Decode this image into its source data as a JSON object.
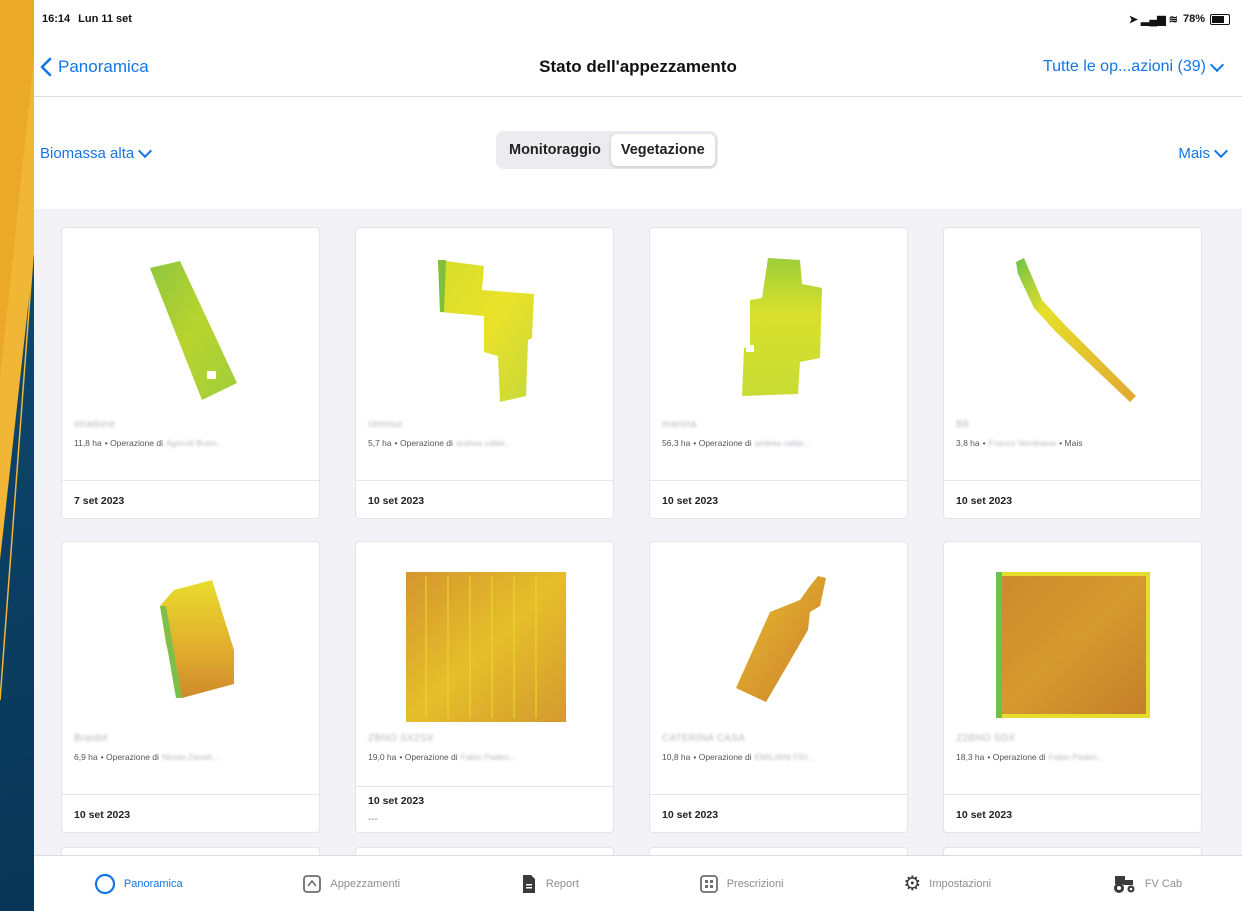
{
  "status_bar": {
    "time": "16:14",
    "date": "Lun 11 set",
    "signal": "↗ .  ıl ◠",
    "battery": "78%"
  },
  "navbar": {
    "back_label": "Panoramica",
    "title": "Stato dell'appezzamento",
    "operations_filter": "Tutte le op...azioni (39)"
  },
  "filters": {
    "layer": "Biomassa alta",
    "segments": [
      {
        "label": "Monitoraggio",
        "active": false
      },
      {
        "label": "Vegetazione",
        "active": true
      }
    ],
    "crop": "Mais"
  },
  "cards": [
    {
      "name": "stradone",
      "area": "11,8 ha",
      "op": "• Operazione di",
      "user": "Agricoli Bram...",
      "suffix": "",
      "date": "7 set 2023",
      "extra": ""
    },
    {
      "name": "cemour",
      "area": "5,7 ha",
      "op": "• Operazione di",
      "user": "andrea callar...",
      "suffix": "",
      "date": "10 set 2023",
      "extra": ""
    },
    {
      "name": "manina",
      "area": "56,3 ha",
      "op": "• Operazione di",
      "user": "andrea callar...",
      "suffix": "",
      "date": "10 set 2023",
      "extra": ""
    },
    {
      "name": "B8",
      "area": "3,8 ha",
      "op": "•",
      "user": "Franco Vendrame",
      "suffix": "• Mais",
      "date": "10 set 2023",
      "extra": ""
    },
    {
      "name": "Braidot",
      "area": "6,9 ha",
      "op": "• Operazione di",
      "user": "Nicola Zanett...",
      "suffix": "",
      "date": "10 set 2023",
      "extra": ""
    },
    {
      "name": "ZBNO SX2SX",
      "area": "19,0 ha",
      "op": "• Operazione di",
      "user": "Fabio Paderi...",
      "suffix": "",
      "date": "10 set 2023",
      "extra": "---"
    },
    {
      "name": "CATERINA CASA",
      "area": "10,8 ha",
      "op": "• Operazione di",
      "user": "EMILIANI FIO...",
      "suffix": "",
      "date": "10 set 2023",
      "extra": ""
    },
    {
      "name": "Z2BNO SDX",
      "area": "18,3 ha",
      "op": "• Operazione di",
      "user": "Fabio Paderi...",
      "suffix": "",
      "date": "10 set 2023",
      "extra": ""
    }
  ],
  "tabs": [
    {
      "label": "Panoramica",
      "icon": "circle-icon",
      "active": true
    },
    {
      "label": "Appezzamenti",
      "icon": "fields-icon",
      "active": false
    },
    {
      "label": "Report",
      "icon": "document-icon",
      "active": false
    },
    {
      "label": "Prescrizioni",
      "icon": "prescription-icon",
      "active": false
    },
    {
      "label": "Impostazioni",
      "icon": "gear-icon",
      "active": false
    },
    {
      "label": "FV Cab",
      "icon": "tractor-icon",
      "active": false
    }
  ],
  "colors": {
    "accent": "#1476e6",
    "background_slide": "#0a3a5c"
  }
}
